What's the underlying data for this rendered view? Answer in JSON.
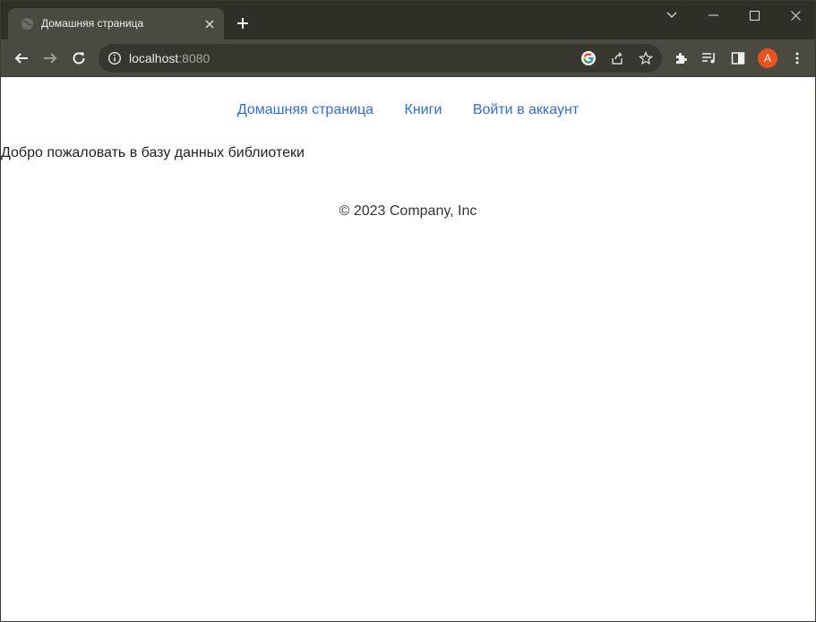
{
  "browser": {
    "tab": {
      "title": "Домашняя страница"
    },
    "address": {
      "host": "localhost",
      "port": ":8080"
    },
    "profile": {
      "initial": "A",
      "color": "#e8531f"
    }
  },
  "page": {
    "nav": [
      {
        "label": "Домашняя страница"
      },
      {
        "label": "Книги"
      },
      {
        "label": "Войти в аккаунт"
      }
    ],
    "welcome": "Добро пожаловать в базу данных библиотеки",
    "footer": "© 2023 Company, Inc",
    "link_color": "#2f6fde"
  }
}
